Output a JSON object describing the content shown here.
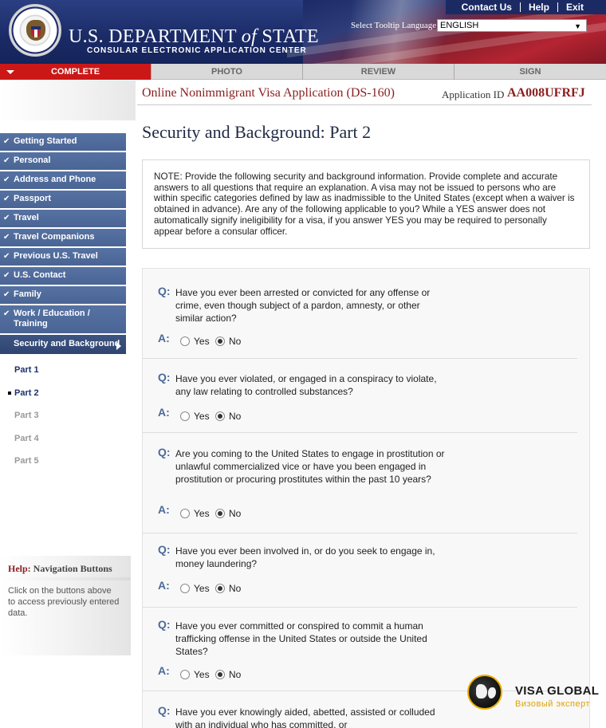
{
  "header": {
    "links": [
      "Contact Us",
      "Help",
      "Exit"
    ],
    "dept_title_part1": "U.S. DEPARTMENT ",
    "dept_title_of": "of",
    "dept_title_part2": " STATE",
    "ceac_title": "CONSULAR ELECTRONIC APPLICATION CENTER",
    "tooltip_label": "Select Tooltip Language",
    "language": "ENGLISH",
    "seal_icon": "department-seal-icon"
  },
  "tabs": [
    {
      "label": "COMPLETE",
      "active": true
    },
    {
      "label": "PHOTO",
      "active": false
    },
    {
      "label": "REVIEW",
      "active": false
    },
    {
      "label": "SIGN",
      "active": false
    }
  ],
  "app": {
    "title": "Online Nonimmigrant Visa Application (DS-160)",
    "id_label": "Application ID",
    "id_value": "AA008UFRFJ"
  },
  "nav": {
    "items": [
      "Getting Started",
      "Personal",
      "Address and Phone",
      "Passport",
      "Travel",
      "Travel Companions",
      "Previous U.S. Travel",
      "U.S. Contact",
      "Family",
      "Work / Education / Training"
    ],
    "current": "Security and Background",
    "sub_items": [
      "Part 1",
      "Part 2",
      "Part 3",
      "Part 4",
      "Part 5"
    ],
    "current_sub": "Part 2"
  },
  "help": {
    "title_label": "Help:",
    "title_topic": "Navigation Buttons",
    "text": "Click on the buttons above to access previously entered data."
  },
  "main": {
    "section_title": "Security and Background: Part 2",
    "note": "NOTE: Provide the following security and background information. Provide complete and accurate answers to all questions that require an explanation. A visa may not be issued to persons who are within specific categories defined by law as inadmissible to the United States (except when a waiver is obtained in advance). Are any of the following applicable to you? While a YES answer does not automatically signify ineligibility for a visa, if you answer YES you may be required to personally appear before a consular officer.",
    "q_label": "Q:",
    "a_label": "A:",
    "yes_label": "Yes",
    "no_label": "No",
    "questions": [
      {
        "text": "Have you ever been arrested or convicted for any offense or crime, even though subject of a pardon, amnesty, or other similar action?",
        "answer": "No"
      },
      {
        "text": "Have you ever violated, or engaged in a conspiracy to violate, any law relating to controlled substances?",
        "answer": "No"
      },
      {
        "text": "Are you coming to the United States to engage in prostitution or unlawful commercialized vice or have you been engaged in prostitution or procuring prostitutes within the past 10 years?",
        "answer": "No"
      },
      {
        "text": "Have you ever been involved in, or do you seek to engage in, money laundering?",
        "answer": "No"
      },
      {
        "text": "Have you ever committed or conspired to commit a human trafficking offense in the United States or outside the United States?",
        "answer": "No"
      },
      {
        "text": "Have you ever knowingly aided, abetted, assisted or colluded with an individual who has committed, or",
        "answer": ""
      }
    ]
  },
  "watermark": {
    "title": "VISA GLOBAL",
    "subtitle": "Визовый эксперт",
    "icon": "globe-icon"
  }
}
